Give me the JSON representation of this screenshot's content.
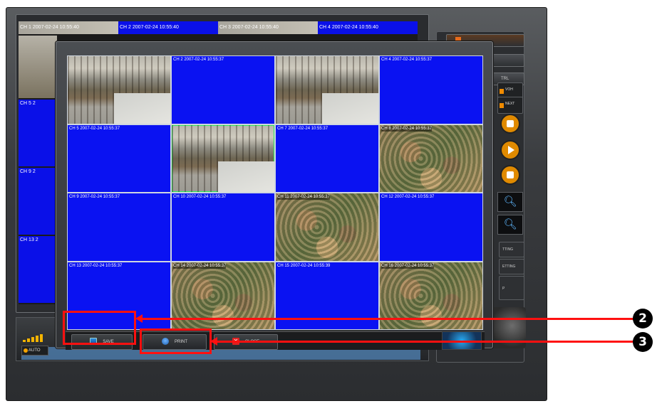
{
  "background_grid": {
    "headers": [
      "CH 1 2007-02-24 10:55:40",
      "CH 2 2007-02-24 10:55:40",
      "CH 3 2007-02-24 10:55:40",
      "CH 4 2007-02-24 10:55:40"
    ],
    "side_labels": [
      "CH 5 2",
      "CH 9 2",
      "CH 13 2"
    ]
  },
  "right_panel": {
    "tabs": [
      "",
      "",
      "TRL",
      "",
      ""
    ],
    "small_buttons": [
      "VOH",
      "NEXT"
    ],
    "text_buttons": [
      "TTING",
      "ETTING",
      "P"
    ]
  },
  "bottom_panel": {
    "auto_label": "AUTO"
  },
  "dialog": {
    "channels": [
      {
        "label": "",
        "feed": "street"
      },
      {
        "label": "CH 2 2007-02-24 10:55:37",
        "feed": "none"
      },
      {
        "label": "",
        "feed": "street"
      },
      {
        "label": "CH 4 2007-02-24 10:55:37",
        "feed": "none"
      },
      {
        "label": "CH 5 2007-02-24 10:55:37",
        "feed": "none"
      },
      {
        "label": "",
        "feed": "street",
        "selected": true
      },
      {
        "label": "CH 7 2007-02-24 10:55:37",
        "feed": "none"
      },
      {
        "label": "CH 8 2007-02-24 10:55:37",
        "feed": "flower"
      },
      {
        "label": "CH 9 2007-02-24 10:55:37",
        "feed": "none"
      },
      {
        "label": "CH 10 2007-02-24 10:55:37",
        "feed": "none"
      },
      {
        "label": "CH 11 2007-02-24 10:55:37",
        "feed": "flower"
      },
      {
        "label": "CH 12 2007-02-24 10:55:37",
        "feed": "none"
      },
      {
        "label": "CH 13 2007-02-24 10:55:37",
        "feed": "none"
      },
      {
        "label": "CH 14 2007-02-24 10:55:37",
        "feed": "flower"
      },
      {
        "label": "CH 15 2007-02-24 10:55:39",
        "feed": "none"
      },
      {
        "label": "CH 16 2007-02-24 10:55:37",
        "feed": "flower"
      }
    ],
    "buttons": {
      "save": "SAVE",
      "print": "PRINT",
      "close": "CLOSE"
    }
  },
  "annotations": {
    "callout_2": "2",
    "callout_3": "3",
    "color": "#ff1010"
  }
}
